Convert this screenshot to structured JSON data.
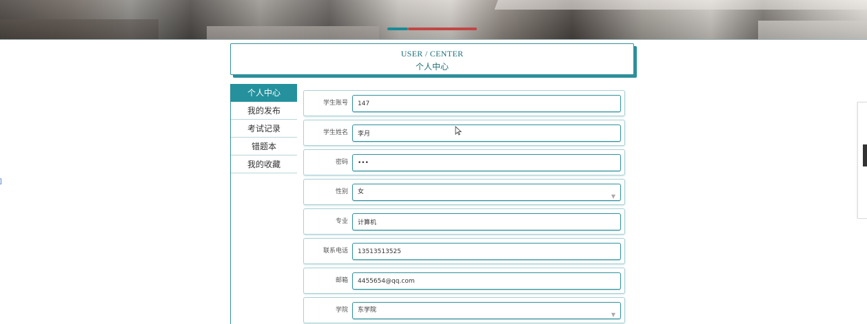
{
  "header": {
    "title_en": "USER / CENTER",
    "title_zh": "个人中心"
  },
  "sidebar": {
    "items": [
      {
        "label": "个人中心",
        "active": true
      },
      {
        "label": "我的发布",
        "active": false
      },
      {
        "label": "考试记录",
        "active": false
      },
      {
        "label": "错题本",
        "active": false
      },
      {
        "label": "我的收藏",
        "active": false
      }
    ]
  },
  "form": {
    "fields": [
      {
        "label": "学生账号",
        "type": "input",
        "value": "147"
      },
      {
        "label": "学生姓名",
        "type": "input",
        "value": "李月"
      },
      {
        "label": "密码",
        "type": "input",
        "value": "•••"
      },
      {
        "label": "性别",
        "type": "select",
        "value": "女"
      },
      {
        "label": "专业",
        "type": "input",
        "value": "计算机"
      },
      {
        "label": "联系电话",
        "type": "input",
        "value": "13513513525"
      },
      {
        "label": "邮箱",
        "type": "input",
        "value": "4455654@qq.com"
      },
      {
        "label": "学院",
        "type": "select",
        "value": "东学院"
      }
    ]
  },
  "colors": {
    "accent": "#24919d",
    "border": "#2d8f9a",
    "carousel_inactive": "#c24545"
  },
  "icons": {
    "select_caret": "chevron-down-icon",
    "cursor": "mouse-pointer-icon"
  },
  "misc": {
    "left_mark": "]"
  }
}
